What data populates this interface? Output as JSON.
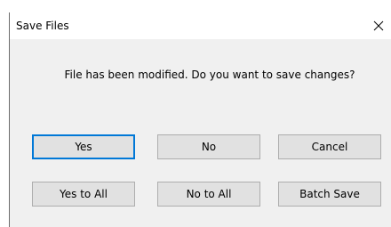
{
  "dialog": {
    "title": "Save Files",
    "message": "File has been modified. Do you want to save changes?"
  },
  "buttons": {
    "yes": "Yes",
    "no": "No",
    "cancel": "Cancel",
    "yes_to_all": "Yes to All",
    "no_to_all": "No to All",
    "batch_save": "Batch Save"
  },
  "colors": {
    "accent": "#0078d7",
    "dialog_bg": "#f0f0f0",
    "button_bg": "#e1e1e1",
    "button_border": "#adadad"
  },
  "icons": {
    "close": "close-icon"
  }
}
